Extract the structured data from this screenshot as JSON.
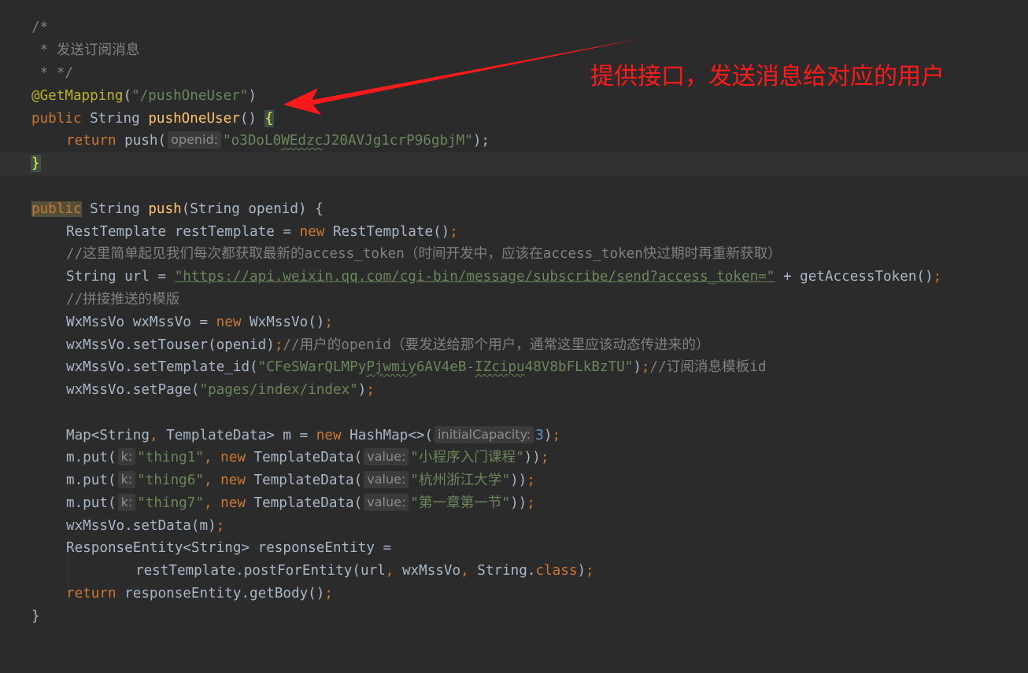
{
  "annotation": {
    "text": "提供接口，发送消息给对应的用户",
    "color": "#ff1a1a"
  },
  "colors": {
    "background": "#2b2b2b",
    "default_text": "#a9b7c6",
    "keyword": "#cc7832",
    "string": "#6a8759",
    "comment": "#808080",
    "annotation": "#bbb529",
    "method_declaration": "#ffc66d",
    "number": "#6897bb",
    "inlay_hint_bg": "#3b3b3b",
    "inlay_hint_text": "#8c8c8c"
  },
  "code": {
    "l1": {
      "t1": "/*"
    },
    "l2": {
      "t1": " * 发送订阅消息"
    },
    "l3": {
      "t1": " * */"
    },
    "l4": {
      "t1": "@GetMapping",
      "t2": "(",
      "t3": "\"/pushOneUser\"",
      "t4": ")"
    },
    "l5": {
      "t1": "public",
      "t2": " String ",
      "t3": "pushOneUser",
      "t4": "() ",
      "t5": "{"
    },
    "l6": {
      "t1": "return",
      "t2": " push(",
      "hint": "openid:",
      "t3": "\"o3DoL0",
      "t4": "WEdzc",
      "t5": "J20AVJg1crP96gbjM\"",
      "t6": ");"
    },
    "l7": {
      "t1": "}"
    },
    "l9": {
      "t1": "public",
      "t2": " String ",
      "t3": "push",
      "t4": "(String openid) {"
    },
    "l10": {
      "t1": "RestTemplate restTemplate = ",
      "t2": "new",
      "t3": " RestTemplate()",
      "t4": ";"
    },
    "l11": {
      "t1": "//这里简单起见我们每次都获取最新的access_token（时间开发中，应该在access_token快过期时再重新获取）"
    },
    "l12": {
      "t1": "String url = ",
      "t2": "\"https://api.weixin.qq.com/cgi-bin/message/subscribe/send?access_token=\"",
      "t3": " + getAccessToken()",
      "t4": ";"
    },
    "l13": {
      "t1": "//拼接推送的模版"
    },
    "l14": {
      "t1": "WxMssVo wxMssVo = ",
      "t2": "new",
      "t3": " WxMssVo()",
      "t4": ";"
    },
    "l15": {
      "t1": "wxMssVo.setTouser(openid)",
      "t2": ";",
      "t3": "//用户的openid（要发送给那个用户，通常这里应该动态传进来的）"
    },
    "l16": {
      "t1": "wxMssVo.setTemplate_id(",
      "t2": "\"CFeSWarQLMPy",
      "t3": "Pjwmiy",
      "t4": "6AV4eB-",
      "t5": "IZcipu",
      "t6": "48V8bFLkBzTU\"",
      "t7": ")",
      "t8": ";",
      "t9": "//订阅消息模板id"
    },
    "l17": {
      "t1": "wxMssVo.setPage(",
      "t2": "\"pages/index/index\"",
      "t3": ")",
      "t4": ";"
    },
    "l19": {
      "t1": "Map<String",
      "t2": ",",
      "t3": " TemplateData> m = ",
      "t4": "new",
      "t5": " HashMap<>(",
      "hint": "initialCapacity:",
      "t6": "3",
      "t7": ")",
      "t8": ";"
    },
    "l20": {
      "t1": "m.put(",
      "hint": "k:",
      "t2": "\"thing1\"",
      "t3": ",",
      "t4": " ",
      "t5": "new",
      "t6": " TemplateData(",
      "hint2": "value:",
      "t7": "\"小程序入门课程\"",
      "t8": "))",
      "t9": ";"
    },
    "l21": {
      "t1": "m.put(",
      "hint": "k:",
      "t2": "\"thing6\"",
      "t3": ",",
      "t4": " ",
      "t5": "new",
      "t6": " TemplateData(",
      "hint2": "value:",
      "t7": "\"杭州浙江大学\"",
      "t8": "))",
      "t9": ";"
    },
    "l22": {
      "t1": "m.put(",
      "hint": "k:",
      "t2": "\"thing7\"",
      "t3": ",",
      "t4": " ",
      "t5": "new",
      "t6": " TemplateData(",
      "hint2": "value:",
      "t7": "\"第一章第一节\"",
      "t8": "))",
      "t9": ";"
    },
    "l23": {
      "t1": "wxMssVo.setData(m)",
      "t2": ";"
    },
    "l24": {
      "t1": "ResponseEntity<String> responseEntity ="
    },
    "l25": {
      "t1": "restTemplate.postForEntity(url",
      "t2": ",",
      "t3": " wxMssVo",
      "t4": ",",
      "t5": " String.",
      "t6": "class",
      "t7": ")",
      "t8": ";"
    },
    "l26": {
      "t1": "return",
      "t2": " responseEntity.getBody()",
      "t3": ";"
    },
    "l27": {
      "t1": "}"
    }
  }
}
